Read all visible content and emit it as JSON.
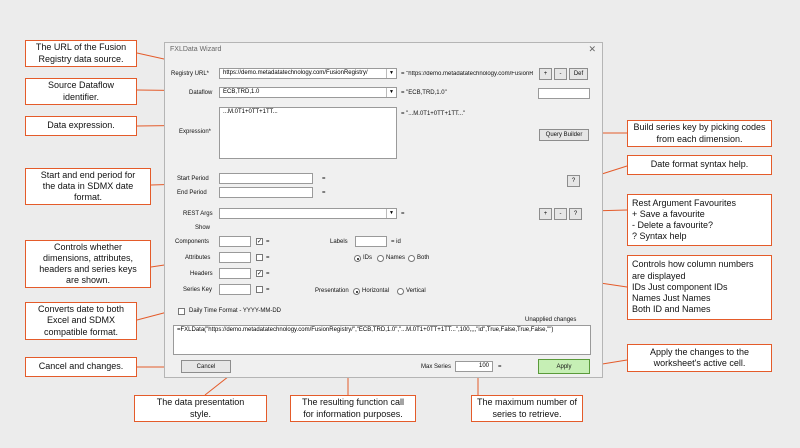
{
  "window": {
    "title": "FXLData Wizard",
    "close": "✕"
  },
  "labels": {
    "registry_url": "Registry URL*",
    "dataflow": "Dataflow",
    "expression": "Expression*",
    "start_period": "Start Period",
    "end_period": "End Period",
    "rest_args": "REST Args",
    "show": "Show",
    "components": "Components",
    "attributes": "Attributes",
    "headers": "Headers",
    "series_key": "Series Key",
    "labels": "Labels",
    "presentation": "Presentation",
    "daily_time_format": "Daily Time Format - YYYY-MM-DD",
    "unapplied_changes": "Unapplied changes",
    "max_series": "Max Series"
  },
  "fields": {
    "registry_url_value": "https://demo.metadatatechnology.com/FusionRegistry/",
    "registry_url_echo": "= \"https://demo.metadatatechnology.com/FusionRx",
    "dataflow_value": "ECB,TRD,1.0",
    "dataflow_echo": "= \"ECB,TRD,1.0\"",
    "expression_value": "...M.0T1+0TT+1TT...",
    "expression_echo": "= \"...M.0T1+0TT+1TT...\"",
    "start_period_echo": "=",
    "end_period_echo": "=",
    "rest_args_echo": "=",
    "components_echo": "=",
    "attributes_echo": "=",
    "headers_echo": "=",
    "series_key_echo": "=",
    "labels_echo": "= id",
    "formula": "=FXLData(\"https://demo.metadatatechnology.com/FusionRegistry/\",\"ECB,TRD,1.0\",\"...M.0T1+0TT+1TT...\",100,,,,\"id\",True,False,True,False,\"\")",
    "max_series_value": "100",
    "max_series_echo": "="
  },
  "options": {
    "labels": [
      "IDs",
      "Names",
      "Both"
    ],
    "presentation": [
      "Horizontal",
      "Vertical"
    ],
    "checkmark": "✓"
  },
  "buttons": {
    "plus": "+",
    "minus": "-",
    "def": "Def",
    "query_builder": "Query Builder",
    "help": "?",
    "cancel": "Cancel",
    "apply": "Apply",
    "dropdown": "▼"
  },
  "callouts": {
    "url": "The URL of the Fusion\nRegistry data source.",
    "dataflow": "Source Dataflow\nidentifier.",
    "expression": "Data expression.",
    "period": "Start and end period for\nthe data in SDMX date\nformat.",
    "controls": "Controls whether\ndimensions, attributes,\nheaders and series keys\nare shown.",
    "converts": "Converts date to both\nExcel and SDMX\ncompatible format.",
    "cancel": "Cancel and changes.",
    "presentation": "The data presentation\nstyle.",
    "formula": "The resulting function call\nfor information purposes.",
    "max_series": "The maximum number of\nseries to retrieve.",
    "query_builder": "Build series key by picking codes\nfrom each dimension.",
    "date_help": "Date format syntax help.",
    "rest_fav": "Rest Argument Favourites\n+     Save a favourite\n-      Delete a favourite?\n?     Syntax help",
    "columns": "Controls how column numbers\nare displayed\nIDs           Just component IDs\nNames     Just Names\nBoth        ID and Names",
    "apply": "Apply the changes to the\nworksheet's active cell."
  },
  "colors": {
    "accent": "#e45b2a",
    "apply": "#c6efb5"
  }
}
